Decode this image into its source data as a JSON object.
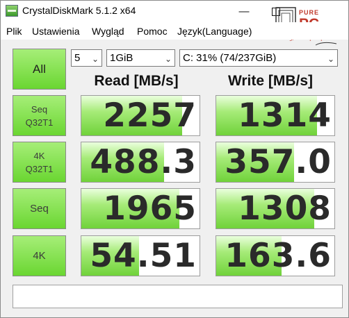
{
  "window": {
    "title": "CrystalDiskMark 5.1.2 x64",
    "minimize": "—",
    "maximize": ""
  },
  "logo": {
    "text": "PURE PC",
    "tagline": "Wiemy, co się kręci !"
  },
  "menu": [
    "Plik",
    "Ustawienia",
    "Wygląd",
    "Pomoc",
    "Język(Language)"
  ],
  "controls": {
    "all_label": "All",
    "count": "5",
    "size": "1GiB",
    "drive": "C: 31% (74/237GiB)"
  },
  "headers": {
    "read": "Read [MB/s]",
    "write": "Write [MB/s]"
  },
  "rows": [
    {
      "line1": "Seq",
      "line2": "Q32T1",
      "read": "2257",
      "write": "1314",
      "read_fill": 0.85,
      "write_fill": 0.85
    },
    {
      "line1": "4K",
      "line2": "Q32T1",
      "read": "488.3",
      "write": "357.0",
      "read_fill": 0.7,
      "write_fill": 0.66
    },
    {
      "line1": "Seq",
      "line2": "",
      "read": "1965",
      "write": "1308",
      "read_fill": 0.83,
      "write_fill": 0.83
    },
    {
      "line1": "4K",
      "line2": "",
      "read": "54.51",
      "write": "163.6",
      "read_fill": 0.49,
      "write_fill": 0.55
    }
  ],
  "status_text": ""
}
